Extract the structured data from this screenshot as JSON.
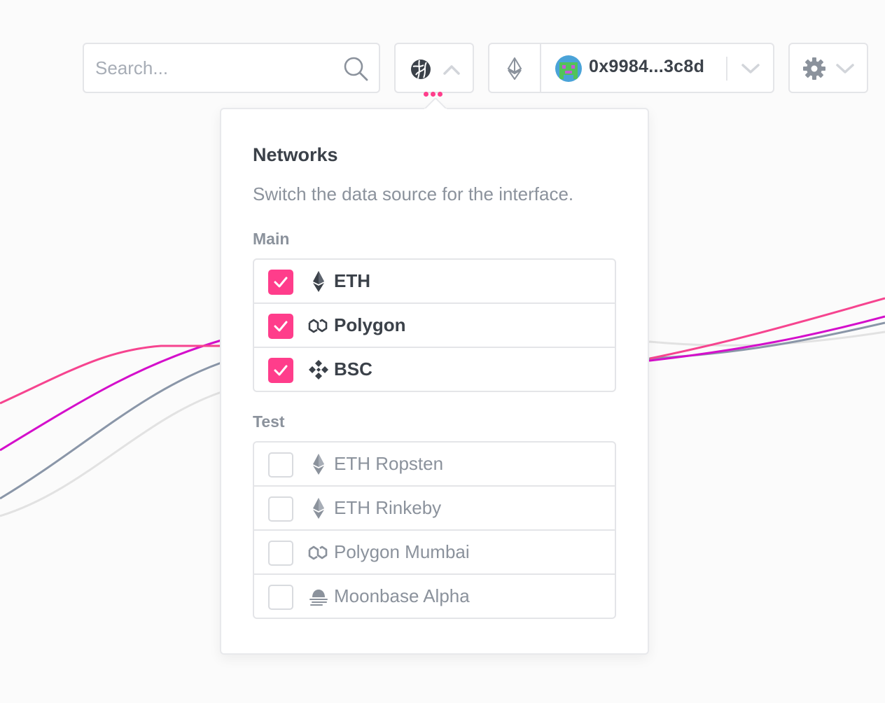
{
  "search": {
    "placeholder": "Search..."
  },
  "account": {
    "address": "0x9984...3c8d"
  },
  "networks_menu": {
    "title": "Networks",
    "subtitle": "Switch the data source for the interface.",
    "groups": [
      {
        "label": "Main",
        "items": [
          {
            "label": "ETH",
            "checked": true,
            "icon": "ethereum-icon"
          },
          {
            "label": "Polygon",
            "checked": true,
            "icon": "polygon-icon"
          },
          {
            "label": "BSC",
            "checked": true,
            "icon": "bsc-icon"
          }
        ]
      },
      {
        "label": "Test",
        "items": [
          {
            "label": "ETH Ropsten",
            "checked": false,
            "icon": "ethereum-icon"
          },
          {
            "label": "ETH Rinkeby",
            "checked": false,
            "icon": "ethereum-icon"
          },
          {
            "label": "Polygon Mumbai",
            "checked": false,
            "icon": "polygon-icon"
          },
          {
            "label": "Moonbase Alpha",
            "checked": false,
            "icon": "moonbeam-icon"
          }
        ]
      }
    ]
  },
  "colors": {
    "accent": "#ff3d8b",
    "line_pink": "#f6448f",
    "line_magenta": "#d40fcb",
    "line_slate": "#8a96a8",
    "line_light": "#e2e2e2"
  }
}
